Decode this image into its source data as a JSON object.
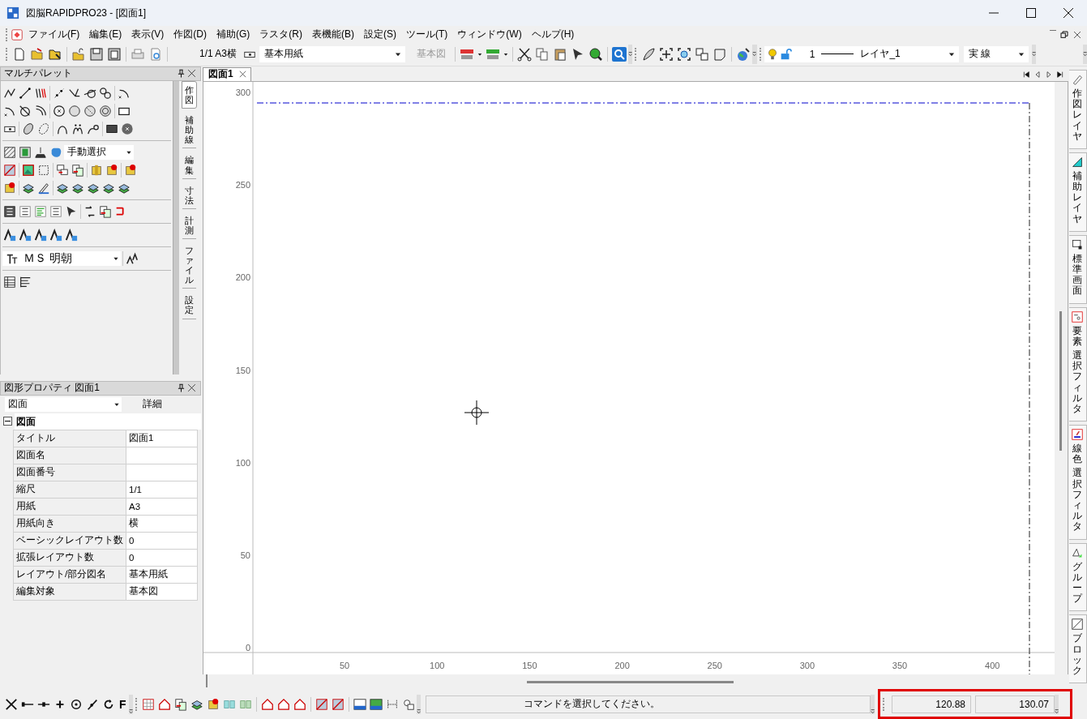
{
  "window": {
    "title": "図脳RAPIDPRO23 - [図面1]"
  },
  "menu": [
    "ファイル(F)",
    "編集(E)",
    "表示(V)",
    "作図(D)",
    "補助(G)",
    "ラスタ(R)",
    "表機能(B)",
    "設定(S)",
    "ツール(T)",
    "ウィンドウ(W)",
    "ヘルプ(H)"
  ],
  "toolbar": {
    "scale_paper": "1/1 A3横",
    "paper_dropdown": "基本用紙",
    "edit_target": {
      "label": "基本図",
      "disabled": true
    },
    "layer_dropdown": {
      "number": "1",
      "name": "レイヤ_1"
    },
    "line_type": "実 線"
  },
  "palette": {
    "title": "マルチパレット",
    "selection_mode": "手動選択",
    "font": "ＭＳ 明朝",
    "tabs": [
      {
        "label": "作図",
        "selected": true
      },
      {
        "label": "補助線",
        "selected": false
      },
      {
        "label": "編集",
        "selected": false
      },
      {
        "label": "寸法",
        "selected": false
      },
      {
        "label": "計測",
        "selected": false
      },
      {
        "label": "ファイル",
        "selected": false
      },
      {
        "label": "設定",
        "selected": false
      }
    ]
  },
  "properties": {
    "title": "図形プロパティ 図面1",
    "object_type": "図面",
    "detail_button": "詳細",
    "group": {
      "label": "図面",
      "expanded": true
    },
    "rows": [
      {
        "name": "タイトル",
        "value": "図面1"
      },
      {
        "name": "図面名"
      },
      {
        "name": "図面番号"
      },
      {
        "name": "縮尺",
        "value": "1/1"
      },
      {
        "name": "用紙",
        "value": "A3"
      },
      {
        "name": "用紙向き",
        "value": "横"
      },
      {
        "name": "ベーシックレイアウト数",
        "value": "0"
      },
      {
        "name": "拡張レイアウト数",
        "value": "0"
      },
      {
        "name": "レイアウト/部分図名",
        "value": "基本用紙"
      },
      {
        "name": "編集対象",
        "value": "基本図"
      }
    ]
  },
  "drawing": {
    "tab": {
      "label": "図面1",
      "selected": true
    },
    "y_ruler": [
      "300",
      "250",
      "200",
      "150",
      "100",
      "50",
      "0"
    ],
    "x_ruler": [
      "50",
      "100",
      "150",
      "200",
      "250",
      "300",
      "350",
      "400"
    ]
  },
  "side_tabs": [
    [
      "作図レイヤ"
    ],
    [
      "補助レイヤ"
    ],
    [
      "標準画面"
    ],
    [
      "要素",
      "選択フィルタ"
    ],
    [
      "線色",
      "選択フィルタ"
    ],
    [
      "グループ"
    ],
    [
      "ブロック"
    ]
  ],
  "status_bar": {
    "snap_key": "F",
    "message": "コマンドを選択してください。",
    "coordinate_1": "120.88",
    "coordinate_2": "130.07"
  }
}
